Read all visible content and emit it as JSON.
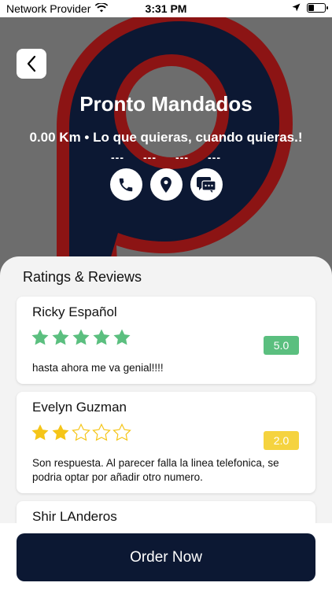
{
  "status_bar": {
    "carrier": "Network Provider",
    "time": "3:31 PM"
  },
  "store": {
    "name": "Pronto Mandados",
    "subtitle": "0.00 Km • Lo que quieras, cuando quieras.!",
    "hours": [
      "---",
      "---",
      "---",
      "---"
    ]
  },
  "reviews_section": {
    "title": "Ratings & Reviews",
    "reviews": [
      {
        "name": "Ricky Español",
        "rating": 5,
        "rating_label": "5.0",
        "badge_color": "#5bbf7f",
        "text": "hasta ahora me va genial!!!!"
      },
      {
        "name": "Evelyn Guzman",
        "rating": 2,
        "rating_label": "2.0",
        "badge_color": "#f5d33f",
        "text": "Son respuesta. Al parecer falla la linea telefonica, se podria optar por añadir otro numero."
      },
      {
        "name": "Shir LAnderos",
        "rating": null,
        "rating_label": "",
        "badge_color": "",
        "text": ""
      }
    ]
  },
  "order_button": {
    "label": "Order Now"
  },
  "colors": {
    "hero_bg": "#6d6d6d",
    "logo_red": "#8c1414",
    "logo_navy": "#0c1833",
    "star_green": "#5bbf7f",
    "star_yellow": "#f5c518"
  },
  "icons": [
    "wifi-icon",
    "location-arrow-icon",
    "battery-icon",
    "back-chevron-icon",
    "phone-icon",
    "map-pin-icon",
    "chat-icon",
    "star-icon"
  ]
}
